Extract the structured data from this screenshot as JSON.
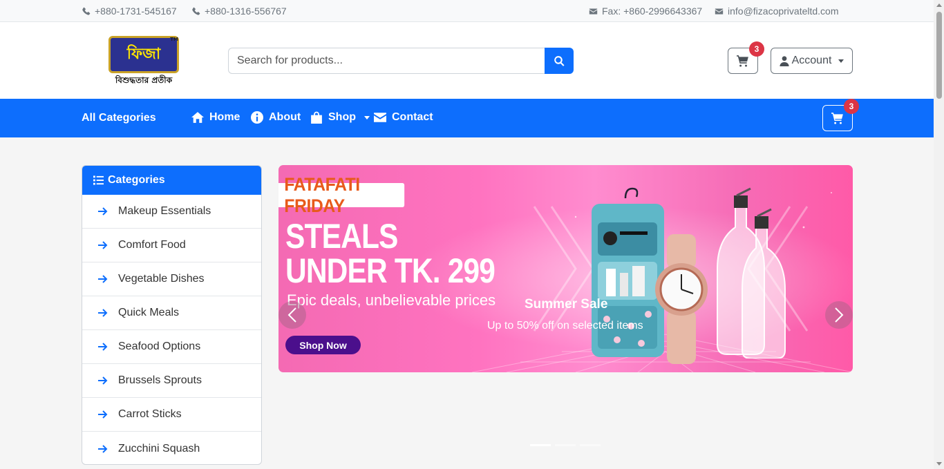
{
  "topbar": {
    "phone1": "+880-1731-545167",
    "phone2": "+880-1316-556767",
    "fax": "Fax: +860-2996643367",
    "email": "info@fizacoprivateltd.com"
  },
  "brand": {
    "logo_text": "ফিজা",
    "tagline": "বিশুদ্ধতার প্রতীক",
    "tm": "TM"
  },
  "search": {
    "placeholder": "Search for products..."
  },
  "header": {
    "cart_count": "3",
    "account_label": "Account"
  },
  "nav": {
    "all_categories": "All Categories",
    "items": [
      {
        "label": "Home",
        "icon": "home-icon"
      },
      {
        "label": "About",
        "icon": "info-icon"
      },
      {
        "label": "Shop",
        "icon": "shopping-bag-icon"
      },
      {
        "label": "Contact",
        "icon": "envelope-icon"
      }
    ],
    "cart_count": "3"
  },
  "categories": {
    "title": "Categories",
    "items": [
      "Makeup Essentials",
      "Comfort Food",
      "Vegetable Dishes",
      "Quick Meals",
      "Seafood Options",
      "Brussels Sprouts",
      "Carrot Sticks",
      "Zucchini Squash"
    ]
  },
  "banner": {
    "tag": "FATAFATI FRIDAY",
    "headline_line1": "STEALS",
    "headline_line2": "UNDER TK. 299",
    "subline": "Epic deals, unbelievable prices",
    "cta": "Shop Now",
    "caption_title": "Summer Sale",
    "caption_text": "Up to 50% off on selected items"
  },
  "colors": {
    "primary": "#0d6efd",
    "badge": "#dc3545",
    "banner_pink": "#ff73c0",
    "friday_orange": "#e85a1c",
    "cta_purple": "#4b0f8c"
  }
}
